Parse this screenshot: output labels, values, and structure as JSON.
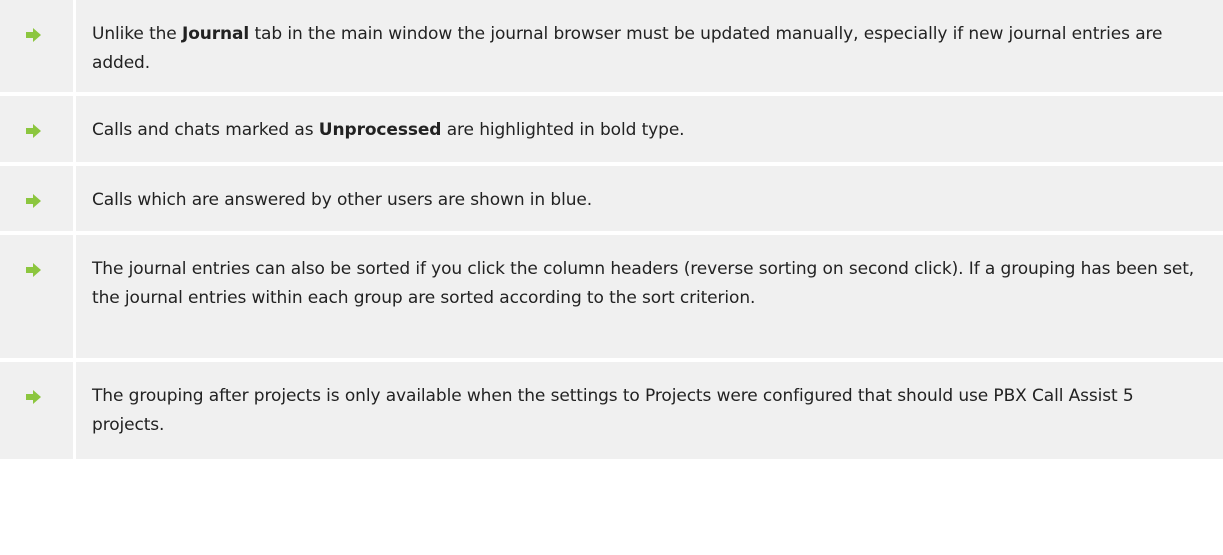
{
  "icon": {
    "name": "arrow-right-icon",
    "color": "#8cc63f",
    "background": "#f0f0f0"
  },
  "notes": [
    {
      "pre": "Unlike the ",
      "bold": "Journal",
      "post": " tab in the main window the journal browser must be updated manually, especially if new journal entries are added."
    },
    {
      "pre": "Calls and chats marked as ",
      "bold": "Unprocessed",
      "post": " are highlighted in bold type."
    },
    {
      "text": "Calls which are answered by other users are shown in blue."
    },
    {
      "text": "The journal entries can also be sorted if you click the column headers (reverse sorting on second click). If a grouping has been set, the journal entries within each group are sorted according to the sort criterion."
    },
    {
      "text": "The grouping after projects is only available when the settings to Projects were configured that should use PBX Call Assist 5 projects."
    }
  ]
}
